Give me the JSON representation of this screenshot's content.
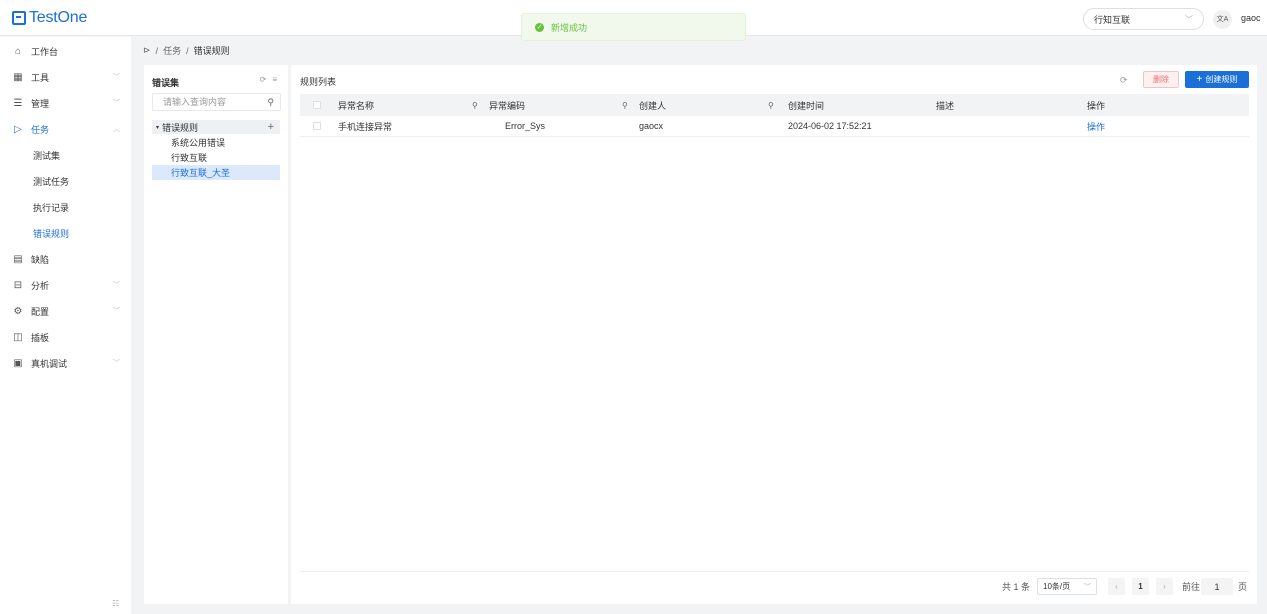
{
  "app": {
    "logo_text": "TestOne",
    "brand_color": "#1a6fd9"
  },
  "toast": {
    "message": "新增成功",
    "type": "success"
  },
  "header": {
    "org_select": "行知互联",
    "lang_icon": "translate-icon",
    "user": "gaoc"
  },
  "sidebar": {
    "items": [
      {
        "label": "工作台",
        "icon": "home-icon"
      },
      {
        "label": "工具",
        "icon": "grid-icon",
        "expandable": true
      },
      {
        "label": "管理",
        "icon": "list-icon",
        "expandable": true
      },
      {
        "label": "任务",
        "icon": "play-icon",
        "expandable": true,
        "expanded": true,
        "active": true
      },
      {
        "label": "缺陷",
        "icon": "doc-icon"
      },
      {
        "label": "分析",
        "icon": "chart-icon",
        "expandable": true
      },
      {
        "label": "配置",
        "icon": "gear-icon",
        "expandable": true
      },
      {
        "label": "插板",
        "icon": "panel-icon"
      },
      {
        "label": "真机调试",
        "icon": "device-icon",
        "expandable": true
      }
    ],
    "sub_items": [
      "测试集",
      "测试任务",
      "执行记录",
      "错误规则"
    ],
    "current_sub": "错误规则"
  },
  "breadcrumb": {
    "parent": "任务",
    "current": "错误规则",
    "separator": "/"
  },
  "tree": {
    "title": "错误集",
    "search_placeholder": "请输入查询内容",
    "root": "错误规则",
    "nodes": [
      "系统公用错误",
      "行致互联",
      "行致互联_大圣"
    ],
    "selected": "行致互联_大圣"
  },
  "table": {
    "title": "规则列表",
    "delete_label": "删除",
    "create_label": "创建规则",
    "columns": [
      "异常名称",
      "异常编码",
      "创建人",
      "创建时间",
      "描述",
      "操作"
    ],
    "rows": [
      {
        "name": "手机连接异常",
        "code": "Error_Sys",
        "creator": "gaocx",
        "created": "2024-06-02 17:52:21",
        "desc": "",
        "action": "操作"
      }
    ]
  },
  "pagination": {
    "total": "共 1 条",
    "page_size": "10条/页",
    "current_page": "1",
    "goto_label": "前往",
    "goto_value": "1",
    "page_unit": "页"
  }
}
